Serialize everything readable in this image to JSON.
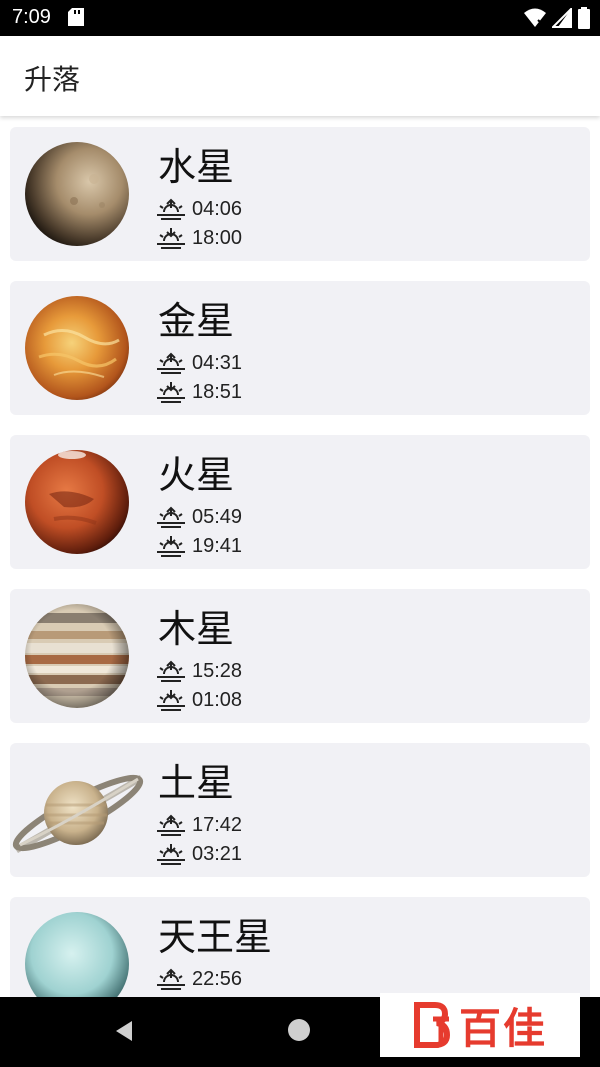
{
  "status_bar": {
    "time": "7:09",
    "icons": [
      "sd-card-icon",
      "wifi-icon",
      "signal-icon",
      "battery-icon"
    ]
  },
  "app_bar": {
    "title": "升落"
  },
  "planets": [
    {
      "name": "水星",
      "rise": "04:06",
      "set": "18:00",
      "image": "mercury"
    },
    {
      "name": "金星",
      "rise": "04:31",
      "set": "18:51",
      "image": "venus"
    },
    {
      "name": "火星",
      "rise": "05:49",
      "set": "19:41",
      "image": "mars"
    },
    {
      "name": "木星",
      "rise": "15:28",
      "set": "01:08",
      "image": "jupiter"
    },
    {
      "name": "土星",
      "rise": "17:42",
      "set": "03:21",
      "image": "saturn"
    },
    {
      "name": "天王星",
      "rise": "22:56",
      "set": "",
      "image": "uranus"
    }
  ],
  "icons": {
    "rise": "sunrise-icon",
    "set": "sunset-icon"
  },
  "watermark": {
    "text": "百佳"
  },
  "colors": {
    "card_bg": "#f1f1f5",
    "bar_bg": "#000000",
    "watermark": "#e63b2e"
  }
}
